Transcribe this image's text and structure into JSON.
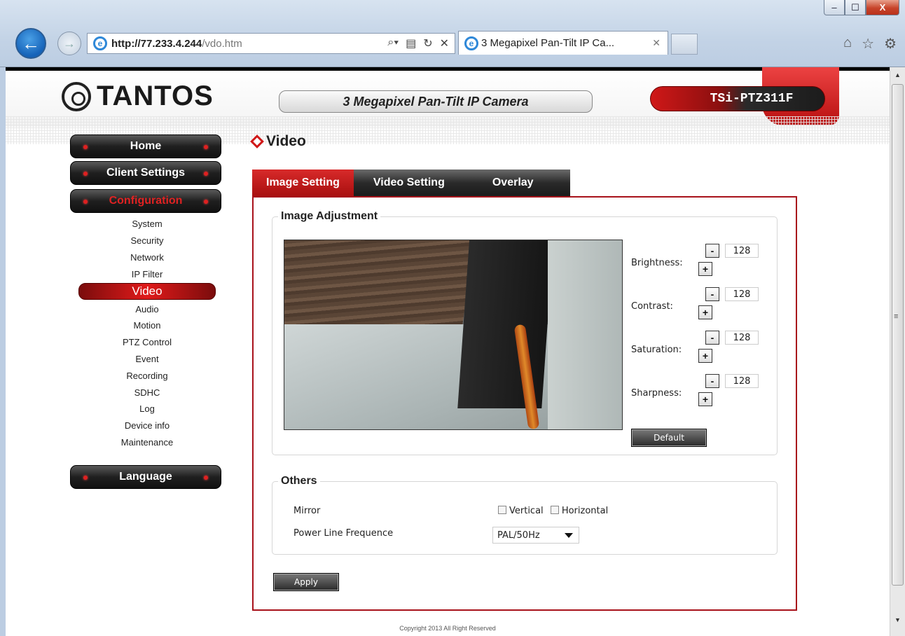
{
  "browser": {
    "url_bold": "http://77.233.4.244",
    "url_rest": "/vdo.htm",
    "tab_title": "3 Megapixel Pan-Tilt IP Ca...",
    "min": "–",
    "max": "☐",
    "close": "X"
  },
  "header": {
    "logo": "TANTOS",
    "product": "3 Megapixel Pan-Tilt IP Camera",
    "model": "TSi-PTZ311F"
  },
  "sidebar": {
    "home": "Home",
    "client_settings": "Client Settings",
    "configuration": "Configuration",
    "items": [
      "System",
      "Security",
      "Network",
      "IP Filter",
      "Video",
      "Audio",
      "Motion",
      "PTZ Control",
      "Event",
      "Recording",
      "SDHC",
      "Log",
      "Device info",
      "Maintenance"
    ],
    "selected": "Video",
    "language": "Language"
  },
  "page": {
    "title": "Video",
    "tabs": [
      "Image Setting",
      "Video Setting",
      "Overlay"
    ],
    "active_tab": "Image Setting"
  },
  "image_adjustment": {
    "legend": "Image Adjustment",
    "controls": [
      {
        "label": "Brightness:",
        "value": "128"
      },
      {
        "label": "Contrast:",
        "value": "128"
      },
      {
        "label": "Saturation:",
        "value": "128"
      },
      {
        "label": "Sharpness:",
        "value": "128"
      }
    ],
    "minus": "-",
    "plus": "+",
    "default_button": "Default"
  },
  "others": {
    "legend": "Others",
    "mirror_label": "Mirror",
    "vertical": "Vertical",
    "horizontal": "Horizontal",
    "vertical_checked": false,
    "horizontal_checked": false,
    "power_label": "Power Line Frequence",
    "power_value": "PAL/50Hz"
  },
  "apply_button": "Apply",
  "footer": "Copyright 2013 All Right Reserved",
  "colors": {
    "accent": "#d01818",
    "panel_border": "#a8121b"
  }
}
